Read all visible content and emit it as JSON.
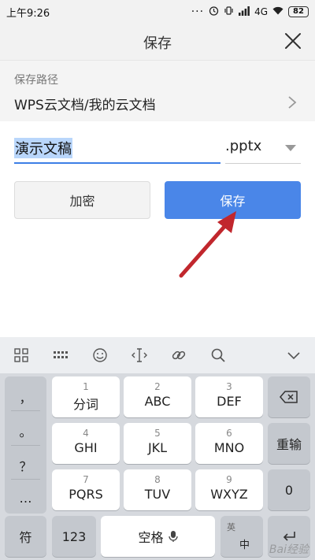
{
  "status": {
    "time": "上午9:26",
    "network": "4G",
    "battery": "82"
  },
  "header": {
    "title": "保存"
  },
  "path": {
    "label": "保存路径",
    "value": "WPS云文档/我的云文档"
  },
  "file": {
    "name": "演示文稿",
    "extension": ".pptx"
  },
  "buttons": {
    "encrypt": "加密",
    "save": "保存"
  },
  "keyboard": {
    "punct": [
      "，",
      "。",
      "？",
      "…"
    ],
    "keys": [
      {
        "num": "1",
        "let": "分词"
      },
      {
        "num": "2",
        "let": "ABC"
      },
      {
        "num": "3",
        "let": "DEF"
      },
      {
        "num": "4",
        "let": "GHI"
      },
      {
        "num": "5",
        "let": "JKL"
      },
      {
        "num": "6",
        "let": "MNO"
      },
      {
        "num": "7",
        "let": "PQRS"
      },
      {
        "num": "8",
        "let": "TUV"
      },
      {
        "num": "9",
        "let": "WXYZ"
      }
    ],
    "retype": "重输",
    "zero": "0",
    "symbol": "符",
    "numbers": "123",
    "space": "空格",
    "lang_top": "英",
    "lang_bottom": "中"
  },
  "watermark": "Bai经验"
}
